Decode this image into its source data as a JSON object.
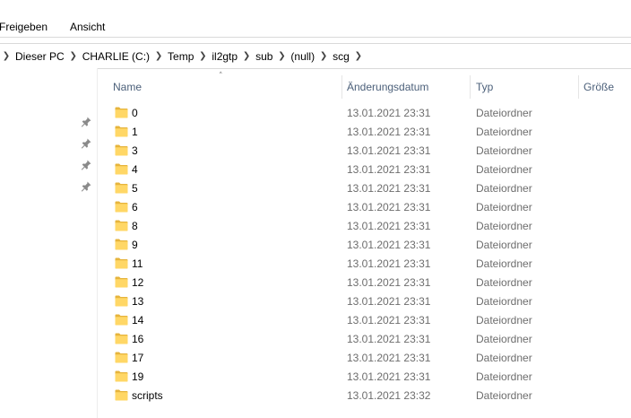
{
  "ribbon": {
    "tabs": [
      "Freigeben",
      "Ansicht"
    ]
  },
  "address": {
    "crumbs": [
      "Dieser PC",
      "CHARLIE (C:)",
      "Temp",
      "il2gtp",
      "sub",
      "(null)",
      "scg"
    ]
  },
  "columns": {
    "name": "Name",
    "date": "Änderungsdatum",
    "type": "Typ",
    "size": "Größe"
  },
  "files": [
    {
      "name": "0",
      "date": "13.01.2021 23:31",
      "type": "Dateiordner"
    },
    {
      "name": "1",
      "date": "13.01.2021 23:31",
      "type": "Dateiordner"
    },
    {
      "name": "3",
      "date": "13.01.2021 23:31",
      "type": "Dateiordner"
    },
    {
      "name": "4",
      "date": "13.01.2021 23:31",
      "type": "Dateiordner"
    },
    {
      "name": "5",
      "date": "13.01.2021 23:31",
      "type": "Dateiordner"
    },
    {
      "name": "6",
      "date": "13.01.2021 23:31",
      "type": "Dateiordner"
    },
    {
      "name": "8",
      "date": "13.01.2021 23:31",
      "type": "Dateiordner"
    },
    {
      "name": "9",
      "date": "13.01.2021 23:31",
      "type": "Dateiordner"
    },
    {
      "name": "11",
      "date": "13.01.2021 23:31",
      "type": "Dateiordner"
    },
    {
      "name": "12",
      "date": "13.01.2021 23:31",
      "type": "Dateiordner"
    },
    {
      "name": "13",
      "date": "13.01.2021 23:31",
      "type": "Dateiordner"
    },
    {
      "name": "14",
      "date": "13.01.2021 23:31",
      "type": "Dateiordner"
    },
    {
      "name": "16",
      "date": "13.01.2021 23:31",
      "type": "Dateiordner"
    },
    {
      "name": "17",
      "date": "13.01.2021 23:31",
      "type": "Dateiordner"
    },
    {
      "name": "19",
      "date": "13.01.2021 23:31",
      "type": "Dateiordner"
    },
    {
      "name": "scripts",
      "date": "13.01.2021 23:32",
      "type": "Dateiordner"
    }
  ],
  "icons": {
    "folder": "folder-icon",
    "pin": "pin-icon",
    "chevron": "chevron-right-icon",
    "sort": "sort-ascending-icon"
  },
  "colors": {
    "folder_fill": "#FFD766",
    "folder_dark": "#E6B43C",
    "header_text": "#4C607A",
    "secondary_text": "#6D6D6D"
  }
}
